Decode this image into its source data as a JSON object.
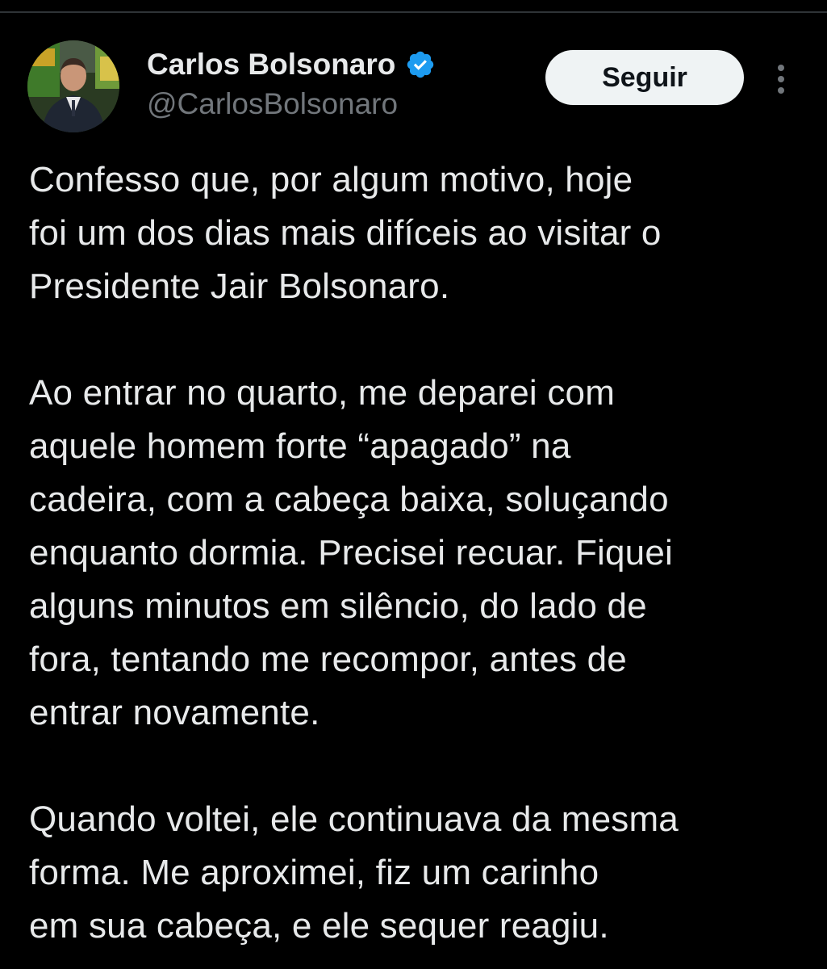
{
  "tweet": {
    "author": {
      "display_name": "Carlos Bolsonaro",
      "handle": "@CarlosBolsonaro",
      "verified_icon": "verified-badge-icon",
      "avatar_icon": "profile-photo"
    },
    "follow_label": "Seguir",
    "more_icon": "more-options-icon",
    "paragraphs": [
      {
        "lines": [
          "Confesso que, por algum motivo, hoje",
          "foi um dos dias mais difíceis ao visitar o",
          "Presidente Jair Bolsonaro."
        ]
      },
      {
        "lines": [
          "Ao entrar no quarto, me deparei com",
          "aquele homem forte “apagado” na",
          "cadeira, com a cabeça baixa, soluçando",
          "enquanto dormia. Precisei recuar. Fiquei",
          "alguns minutos em silêncio, do lado de",
          "fora, tentando me recompor, antes de",
          "entrar novamente."
        ]
      },
      {
        "lines": [
          "Quando voltei, ele continuava da mesma",
          "forma. Me aproximei, fiz um carinho",
          "em sua cabeça, e ele sequer reagiu."
        ]
      }
    ]
  },
  "colors": {
    "background": "#000000",
    "text_primary": "#e7e9ea",
    "text_secondary": "#71767b",
    "verified_blue": "#1d9bf0",
    "follow_bg": "#eff3f4"
  }
}
